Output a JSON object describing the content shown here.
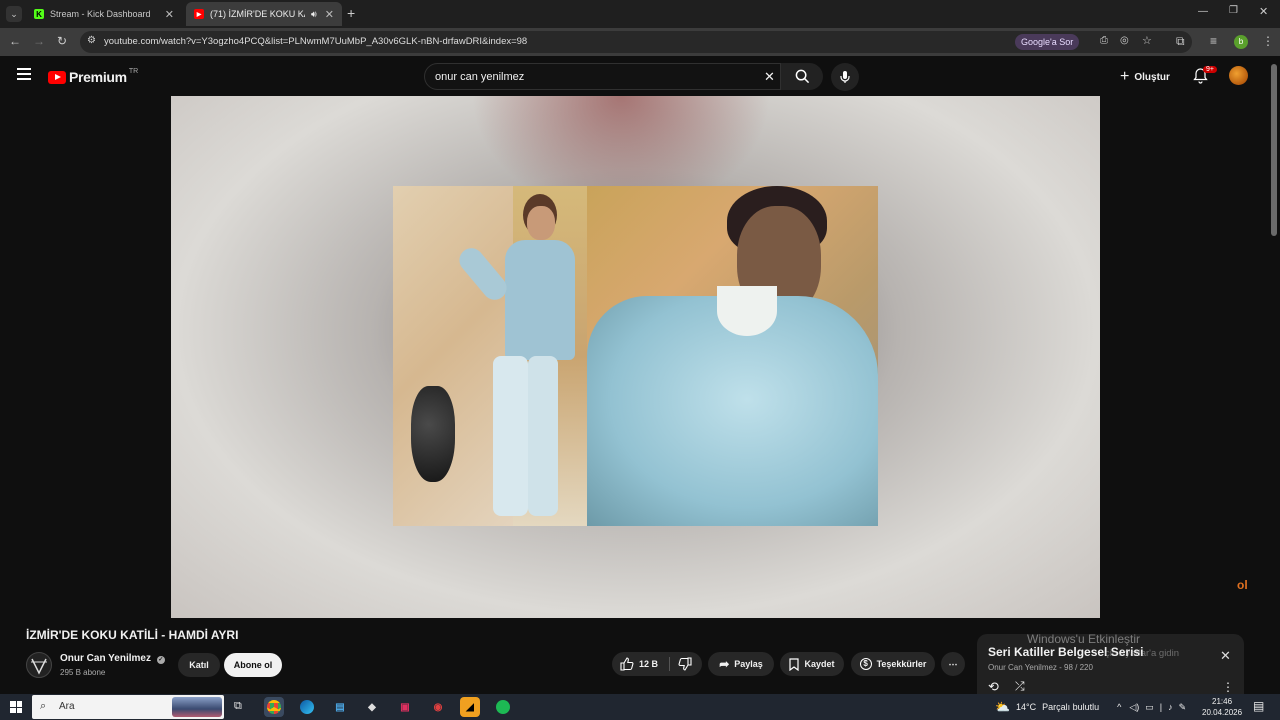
{
  "browser": {
    "tabs": [
      {
        "label": "Stream - Kick Dashboard",
        "favicon": "kick-icon"
      },
      {
        "label": "(71) İZMİR'DE KOKU KATİLİ",
        "favicon": "youtube-icon"
      }
    ],
    "url": "youtube.com/watch?v=Y3ogzho4PCQ&list=PLNwmM7UuMbP_A30v6GLK-nBN-drfawDRI&index=98",
    "google_sor": "Google'a Sor"
  },
  "youtube": {
    "logo_text": "Premium",
    "logo_region": "TR",
    "search_value": "onur can yenilmez",
    "create_label": "Oluştur",
    "notif_badge": "9+"
  },
  "video": {
    "title": "İZMİR'DE KOKU KATİLİ - HAMDİ AYRI",
    "channel": "Onur Can Yenilmez",
    "subscribers": "295 B abone",
    "join_label": "Katıl",
    "subscribe_label": "Abone ol",
    "likes": "12 B",
    "share_label": "Paylaş",
    "save_label": "Kaydet",
    "thanks_label": "Teşekkürler",
    "overlay_logo": "ol"
  },
  "playlist": {
    "title": "Seri Katiller Belgesel Serisi",
    "subtitle": "Onur Can Yenilmez - 98 / 220"
  },
  "watermark": {
    "line1": "Windows'u Etkinleştir",
    "line2": "çin Ayarlar'a gidin"
  },
  "taskbar": {
    "search_placeholder": "Ara",
    "weather": "14°C",
    "weather_desc": "Parçalı bulutlu",
    "time": "21:46",
    "date": "20.04.2026"
  },
  "colors": {
    "youtube_red": "#ff0000",
    "background": "#0f0f0f",
    "pill": "#272727"
  }
}
